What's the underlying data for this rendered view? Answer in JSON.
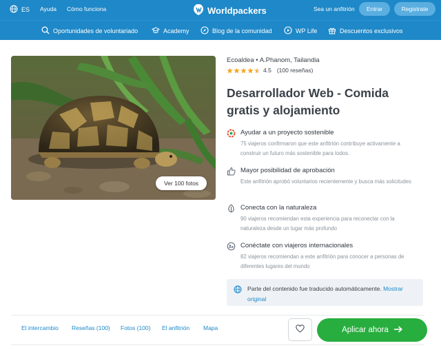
{
  "header": {
    "lang": "ES",
    "help": "Ayuda",
    "how": "Cómo funciona",
    "brand": "Worldpackers",
    "host": "Sea un anfitrión",
    "login": "Entrar",
    "signup": "Registrate"
  },
  "nav": [
    {
      "label": "Oportunidades de voluntariado",
      "icon": "search-icon"
    },
    {
      "label": "Academy",
      "icon": "graduation-cap-icon"
    },
    {
      "label": "Blog de la comunidad",
      "icon": "compass-icon"
    },
    {
      "label": "WP Life",
      "icon": "play-icon"
    },
    {
      "label": "Descuentos exclusivos",
      "icon": "gift-icon"
    }
  ],
  "photo": {
    "view_label": "Ver 100 fotos"
  },
  "listing": {
    "location": "Ecoaldea • A.Phanom, Tailandia",
    "rating": "4.5",
    "reviews": "(100 reseñas)",
    "title": "Desarrollador Web - Comida gratis y alojamiento"
  },
  "features": [
    {
      "icon": "sustainable-icon",
      "title": "Ayudar a un proyecto sostenible",
      "desc": "75 viajeros confirmaron que este anfitrión contribuye activamente a construir un futuro más sostenible para todos."
    },
    {
      "icon": "thumbs-up-icon",
      "title": "Mayor posibilidad de aprobación",
      "desc": "Este anfitrión aprobó voluntarios recientemente y busca más solicitudes"
    },
    {
      "icon": "leaf-icon",
      "title": "Conecta con la naturaleza",
      "desc": "90 viajeros recomiendan esta experiencia para reconectar con la naturaleza desde un lugar más profundo"
    },
    {
      "icon": "globe-people-icon",
      "title": "Conéctate con viajeros internacionales",
      "desc": "82 viajeros recomiendan a este anfitrión para conocer a personas de diferentes lugares del mundo"
    }
  ],
  "notice": {
    "text": "Parte del contenido fue traducido automáticamente.",
    "link": "Mostrar original"
  },
  "tabs": [
    "El intercambio",
    "Reseñas (100)",
    "Fotos (100)",
    "El anfitrión",
    "Mapa"
  ],
  "cta": {
    "apply": "Aplicar ahora"
  },
  "colors": {
    "header": "#1e88c8",
    "accent_green": "#27ae3e",
    "star": "#f5a623"
  }
}
